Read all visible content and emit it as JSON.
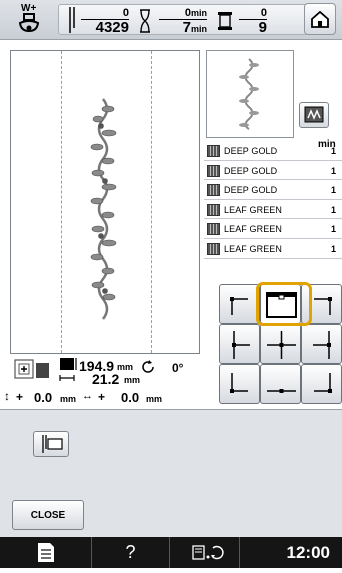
{
  "topbar": {
    "presser_foot_label": "W+",
    "stitch_current": "0",
    "stitch_total": "4329",
    "time_current": "0",
    "time_total": "7",
    "time_unit": "min",
    "colors_current": "0",
    "colors_total": "9",
    "icons": [
      "presser-foot-icon",
      "needle-icon",
      "hourglass-icon",
      "thread-spool-icon",
      "home-icon"
    ]
  },
  "color_list": {
    "header": "min",
    "items": [
      {
        "name": "DEEP GOLD",
        "min": "1"
      },
      {
        "name": "DEEP GOLD",
        "min": "1"
      },
      {
        "name": "DEEP GOLD",
        "min": "1"
      },
      {
        "name": "LEAF GREEN",
        "min": "1"
      },
      {
        "name": "LEAF GREEN",
        "min": "1"
      },
      {
        "name": "LEAF GREEN",
        "min": "1"
      }
    ]
  },
  "info": {
    "size_w": "194.9",
    "size_h": "21.2",
    "size_unit": "mm",
    "angle": "0°",
    "pos_y": "0.0",
    "pos_x": "0.0",
    "pos_unit": "mm",
    "plus_y": "+",
    "plus_x": "+"
  },
  "position_grid": {
    "selected": "top-center"
  },
  "lower_panel": {
    "close_label": "CLOSE"
  },
  "statusbar": {
    "help": "?",
    "time": "12:00"
  },
  "colors": {
    "selection_ring": "#e0a300"
  }
}
